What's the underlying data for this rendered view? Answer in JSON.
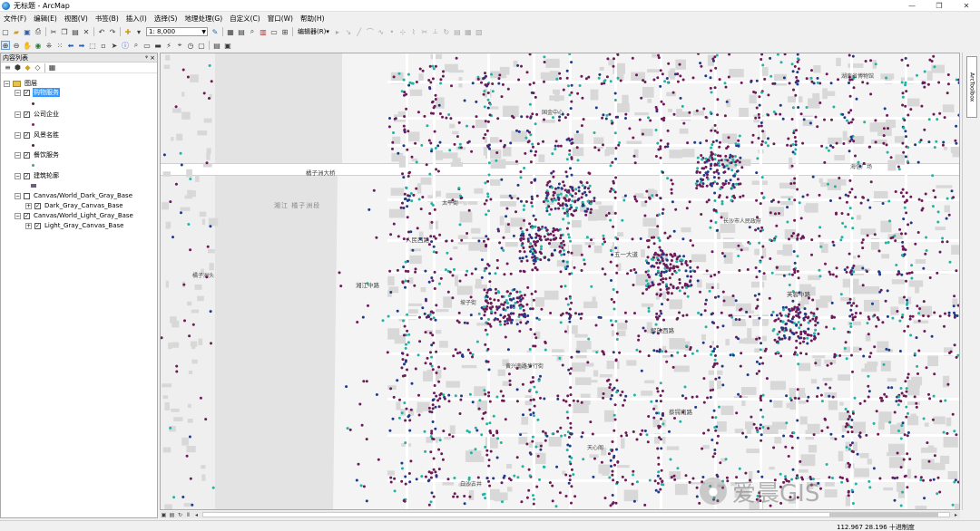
{
  "window": {
    "title": "无标题 - ArcMap",
    "controls": [
      "—",
      "❐",
      "✕"
    ]
  },
  "menu": [
    "文件(F)",
    "编辑(E)",
    "视图(V)",
    "书签(B)",
    "插入(I)",
    "选择(S)",
    "地理处理(G)",
    "自定义(C)",
    "窗口(W)",
    "帮助(H)"
  ],
  "toolbar": {
    "scale": "1: 8,000",
    "editor_label": "编辑器(R)▾"
  },
  "toc": {
    "title": "内容列表",
    "pin": "ᵠ",
    "close": "×",
    "group": "图层",
    "layers": [
      {
        "label": "购物服务",
        "color": "#6e1a58",
        "selected": true
      },
      {
        "label": "公司企业",
        "color": "#8b1e6f"
      },
      {
        "label": "风景名胜",
        "color": "#5a1646"
      },
      {
        "label": "餐饮服务",
        "color": "#22b3a3"
      },
      {
        "label": "建筑轮廓",
        "color": "#6b5f7a"
      }
    ],
    "basemaps": [
      {
        "label": "Canvas/World_Dark_Gray_Base",
        "child": "Dark_Gray_Canvas_Base",
        "checked": false
      },
      {
        "label": "Canvas/World_Light_Gray_Base",
        "child": "Light_Gray_Canvas_Base",
        "checked": true
      }
    ]
  },
  "map": {
    "labels": [
      {
        "text": "橘子洲大桥",
        "kind": "road"
      },
      {
        "text": "湘江 橘子洲段",
        "kind": "water"
      },
      {
        "text": "湘江中路",
        "kind": "road"
      },
      {
        "text": "五一大道",
        "kind": "road"
      },
      {
        "text": "解放西路",
        "kind": "road"
      },
      {
        "text": "黄兴南路步行街",
        "kind": "poi"
      },
      {
        "text": "长沙市人民政府",
        "kind": "poi"
      },
      {
        "text": "天心阁",
        "kind": "poi"
      },
      {
        "text": "坡子街",
        "kind": "poi"
      },
      {
        "text": "太平街",
        "kind": "poi"
      },
      {
        "text": "橘子洲头",
        "kind": "poi"
      },
      {
        "text": "芙蓉中路",
        "kind": "road"
      },
      {
        "text": "蔡锷南路",
        "kind": "road"
      },
      {
        "text": "人民西路",
        "kind": "road"
      },
      {
        "text": "国金中心",
        "kind": "poi"
      },
      {
        "text": "海信广场",
        "kind": "poi"
      },
      {
        "text": "湖南省博物馆",
        "kind": "poi"
      },
      {
        "text": "白沙古井",
        "kind": "poi"
      }
    ],
    "colors": {
      "poi_dark": "#6e1a58",
      "poi_teal": "#22b3a3",
      "poi_blue": "#1f3a8a",
      "building": "#d8d8d8",
      "water": "#e3e3e3",
      "land": "#f4f4f4",
      "road": "#ffffff"
    }
  },
  "right_dock": {
    "tab": "ArcToolbox"
  },
  "status": {
    "coords": "112.967  28.196 十进制度"
  },
  "watermark": {
    "text": "爱晨GIS"
  }
}
